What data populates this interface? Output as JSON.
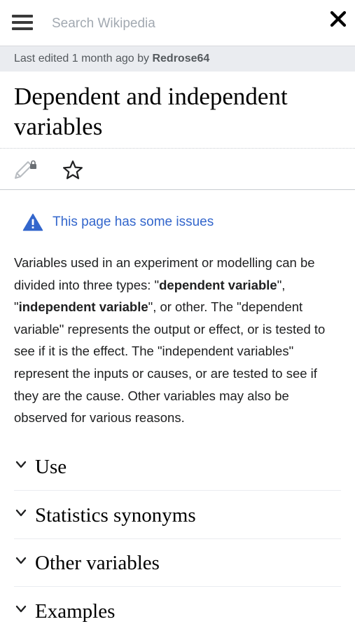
{
  "header": {
    "search_placeholder": "Search Wikipedia"
  },
  "last_edited": {
    "prefix": "Last edited 1 month ago by ",
    "user": "Redrose64"
  },
  "article": {
    "title": "Dependent and independent variables"
  },
  "issues": {
    "label": "This page has some issues"
  },
  "intro": {
    "part1": "Variables used in an experiment or modelling can be divided into three types: \"",
    "bold1": "dependent variable",
    "part2": "\", \"",
    "bold2": "independent variable",
    "part3": "\", or other. The \"dependent variable\" represents the output or effect, or is tested to see if it is the effect. The \"independent variables\" represent the inputs or causes, or are tested to see if they are the cause. Other variables may also be observed for various reasons."
  },
  "sections": [
    {
      "title": "Use"
    },
    {
      "title": "Statistics synonyms"
    },
    {
      "title": "Other variables"
    },
    {
      "title": "Examples"
    }
  ],
  "icons": {
    "menu": "hamburger-menu-icon",
    "close": "close-icon",
    "edit": "edit-locked-pencil-icon",
    "watch": "star-outline-icon",
    "issues": "warning-triangle-icon",
    "section_toggle": "chevron-down-icon"
  },
  "colors": {
    "link": "#3366cc",
    "banner_bg": "#eaecf0",
    "text": "#202122",
    "muted": "#54595d"
  }
}
